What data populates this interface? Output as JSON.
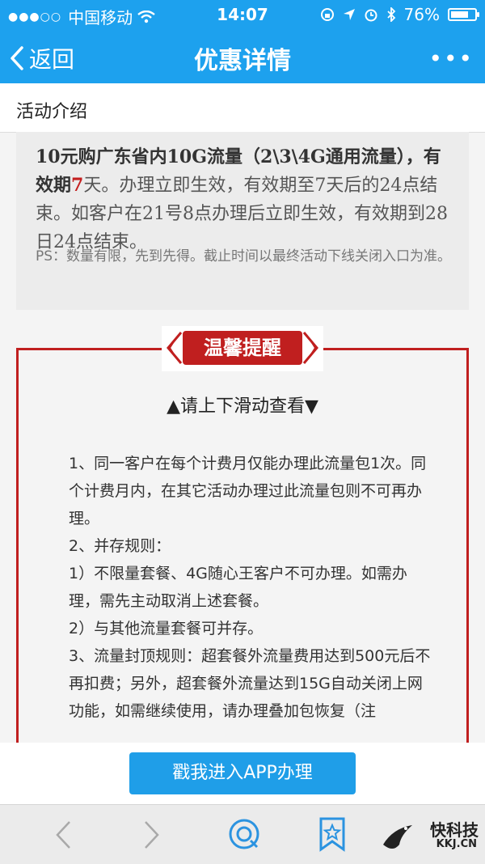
{
  "status": {
    "carrier": "中国移动",
    "time": "14:07",
    "battery": "76%",
    "battery_level": 0.76
  },
  "nav": {
    "back_label": "返回",
    "title": "优惠详情",
    "more": "•••"
  },
  "section": {
    "title": "活动介绍"
  },
  "intro": {
    "p1": "10元购广东省内10G流量（2\\3\\4G通用流量），有效期",
    "days": "7",
    "p2": "天。办理立即生效，有效期至7天后的24点结束。如客户在21号8点办理后立即生效，有效期到28日24点结束。",
    "ps": "PS：数量有限，先到先得。截止时间以最终活动下线关闭入口为准。"
  },
  "reminder": {
    "badge": "温馨提醒",
    "scroll_hint": "▲请上下滑动查看▼",
    "rules": [
      "1、同一客户在每个计费月仅能办理此流量包1次。同个计费月内，在其它活动办理过此流量包则不可再办理。",
      "2、并存规则：",
      "1）不限量套餐、4G随心王客户不可办理。如需办理，需先主动取消上述套餐。",
      "2）与其他流量套餐可并存。",
      "3、流量封顶规则：超套餐外流量费用达到500元后不再扣费；另外，超套餐外流量达到15G自动关闭上网功能，如需继续使用，请办理叠加包恢复（注"
    ]
  },
  "cta": {
    "label": "戳我进入APP办理"
  },
  "watermark": {
    "name": "快科技",
    "domain": "KKJ.CN"
  },
  "colors": {
    "nav_blue": "#1da1ee",
    "accent_red": "#c01f1f",
    "button_blue": "#1f9ee8"
  }
}
